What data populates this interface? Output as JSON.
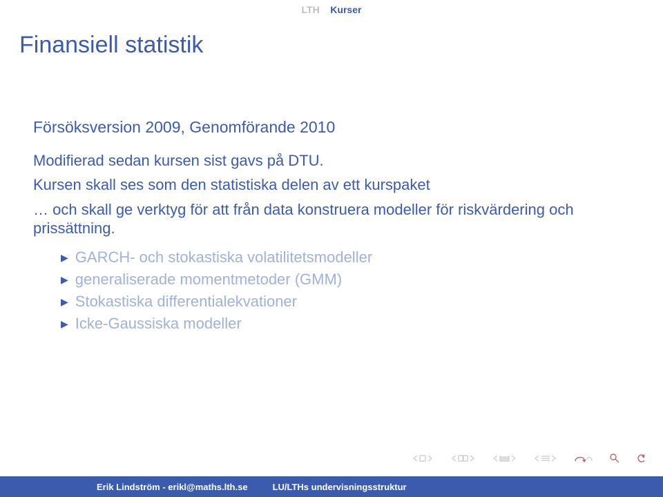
{
  "header": {
    "inactive": "LTH",
    "active": "Kurser"
  },
  "title": "Finansiell statistik",
  "subhead": "Försöksversion 2009, Genomförande 2010",
  "paras": [
    "Modifierad sedan kursen sist gavs på DTU.",
    "Kursen skall ses som den statistiska delen av ett kurspaket",
    "… och skall ge verktyg för att från data konstruera modeller för riskvärdering och prissättning."
  ],
  "bullets": [
    "GARCH- och stokastiska volatilitetsmodeller",
    "generaliserade momentmetoder (GMM)",
    "Stokastiska differentialekvationer",
    "Icke-Gaussiska modeller"
  ],
  "footer": {
    "left": "Erik Lindström - erikl@maths.lth.se",
    "right": "LU/LTHs undervisningsstruktur"
  }
}
